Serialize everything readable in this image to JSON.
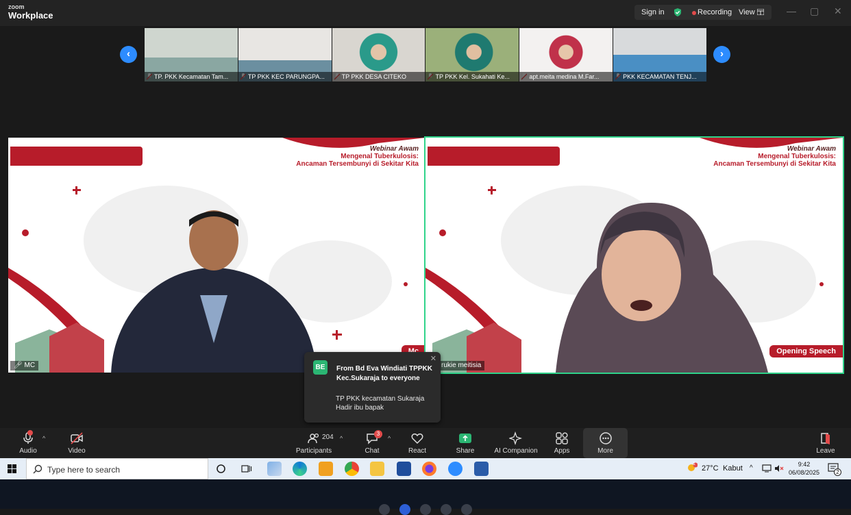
{
  "app": {
    "brand_small": "zoom",
    "brand_name": "Workplace"
  },
  "topbar": {
    "sign_in": "Sign in",
    "recording": "Recording",
    "view": "View"
  },
  "thumbnails": [
    {
      "label": "TP. PKK Kecamatan Tam..."
    },
    {
      "label": "TP PKK KEC PARUNGPA..."
    },
    {
      "label": "TP PKK DESA CITEKO"
    },
    {
      "label": "TP PKK Kel. Sukahati Ke..."
    },
    {
      "label": "apt.meita medina M.Far..."
    },
    {
      "label": "PKK KECAMATAN TENJ..."
    }
  ],
  "slides": {
    "title_line1": "Webinar Awam",
    "title_line2": "Mengenal Tuberkulosis:",
    "title_line3": "Ancaman Tersembunyi di Sekitar Kita"
  },
  "tiles": [
    {
      "name": "MC",
      "tag": "Mc"
    },
    {
      "name": "rukie meitisia",
      "tag": "Opening Speech"
    }
  ],
  "chat_popup": {
    "avatar": "BE",
    "from": "From Bd Eva Windiati TPPKK Kec.Sukaraja to everyone",
    "message_line1": "TP PKK kecamatan Sukaraja",
    "message_line2": "Hadir ibu bapak"
  },
  "toolbar": {
    "audio": "Audio",
    "video": "Video",
    "participants": "Participants",
    "participants_count": "204",
    "chat": "Chat",
    "chat_badge": "3",
    "react": "React",
    "share": "Share",
    "ai_companion": "AI Companion",
    "apps": "Apps",
    "more": "More",
    "leave": "Leave"
  },
  "taskbar": {
    "search_placeholder": "Type here to search",
    "weather_temp": "27°C",
    "weather_desc": "Kabut",
    "weather_badge": "1",
    "time": "9:42",
    "date": "06/08/2025",
    "notification_count": "2"
  },
  "colors": {
    "accent": "#2d8cff",
    "active_speaker": "#2fd38a",
    "brand_red": "#b71c2a",
    "record_red": "#e24b4b"
  }
}
